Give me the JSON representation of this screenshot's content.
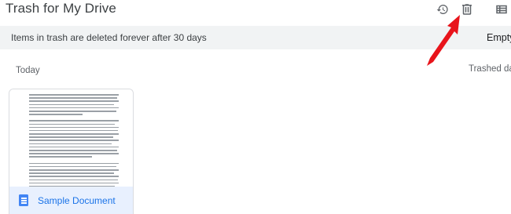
{
  "header": {
    "title": "Trash for My Drive",
    "icons": [
      "history-icon",
      "trash-icon",
      "list-view-icon"
    ]
  },
  "banner": {
    "message": "Items in trash are deleted forever after 30 days",
    "empty_button": "Empty"
  },
  "list": {
    "section_label": "Today",
    "sort_label": "Trashed date"
  },
  "files": [
    {
      "name": "Sample Document",
      "type": "google-docs-icon"
    }
  ],
  "annotation": {
    "arrow_color": "#e8141b"
  },
  "colors": {
    "accent": "#1a73e8",
    "banner_bg": "#f1f3f4",
    "card_footer_bg": "#e8f0fe"
  }
}
